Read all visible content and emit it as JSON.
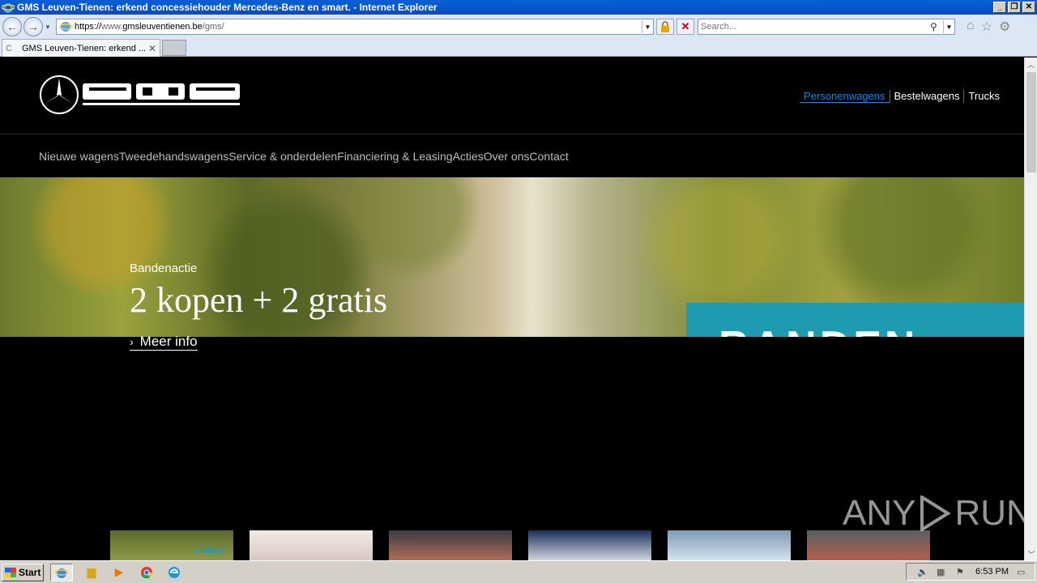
{
  "window": {
    "title": "GMS Leuven-Tienen: erkend concessiehouder Mercedes-Benz en smart. - Internet Explorer",
    "buttons": {
      "minimize": "_",
      "restore": "❐",
      "close": "✕"
    }
  },
  "addressbar": {
    "url_scheme": "https://",
    "url_sub": "www.",
    "url_host": "gmsleuventienen.be",
    "url_path": "/gms/",
    "search_placeholder": "Search..."
  },
  "tabs": [
    {
      "label": "GMS Leuven-Tienen: erkend ..."
    }
  ],
  "site": {
    "brand_links": [
      "Personenwagens",
      "Bestelwagens",
      "Trucks"
    ],
    "nav": [
      "Nieuwe wagens",
      "Tweedehandswagens",
      "Service & onderdelen",
      "Financiering & Leasing",
      "Acties",
      "Over ons",
      "Contact"
    ],
    "hero": {
      "kicker": "Bandenactie",
      "headline": "2 kopen + 2 gratis",
      "panel_text": "BANDEN",
      "cta": "Meer info"
    },
    "thumb_label": "BANDEN"
  },
  "watermark": {
    "text1": "ANY",
    "text2": "RUN"
  },
  "taskbar": {
    "start": "Start",
    "clock": "6:53 PM"
  },
  "colors": {
    "accent": "#1c82e3",
    "panel": "#1f9bb0"
  }
}
